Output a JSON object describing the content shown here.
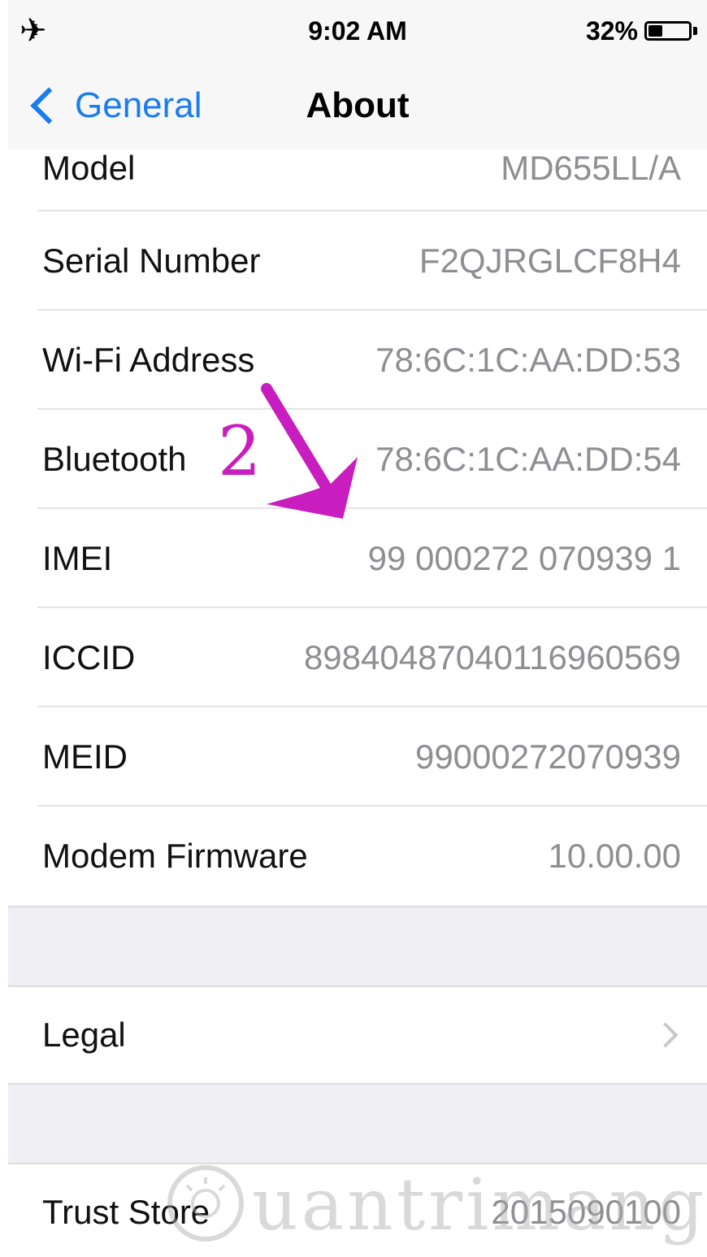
{
  "status_bar": {
    "time": "9:02 AM",
    "battery_percent": "32%",
    "battery_level": 0.32,
    "airplane_icon": "airplane-icon"
  },
  "nav": {
    "back_label": "General",
    "title": "About"
  },
  "rows": [
    {
      "label": "Model",
      "value": "MD655LL/A"
    },
    {
      "label": "Serial Number",
      "value": "F2QJRGLCF8H4"
    },
    {
      "label": "Wi-Fi Address",
      "value": "78:6C:1C:AA:DD:53"
    },
    {
      "label": "Bluetooth",
      "value": "78:6C:1C:AA:DD:54"
    },
    {
      "label": "IMEI",
      "value": "99 000272 070939 1"
    },
    {
      "label": "ICCID",
      "value": "89840487040116960569"
    },
    {
      "label": "MEID",
      "value": "99000272070939"
    },
    {
      "label": "Modem Firmware",
      "value": "10.00.00"
    }
  ],
  "legal": {
    "label": "Legal"
  },
  "trust_store": {
    "label": "Trust Store",
    "value": "2015090100"
  },
  "annotation": {
    "number": "2",
    "color": "#c81ec0"
  },
  "watermark": {
    "text": "uantrimang"
  },
  "colors": {
    "accent": "#1a7cf0",
    "value_gray": "#8e8e93",
    "group_bg": "#efeff4"
  }
}
